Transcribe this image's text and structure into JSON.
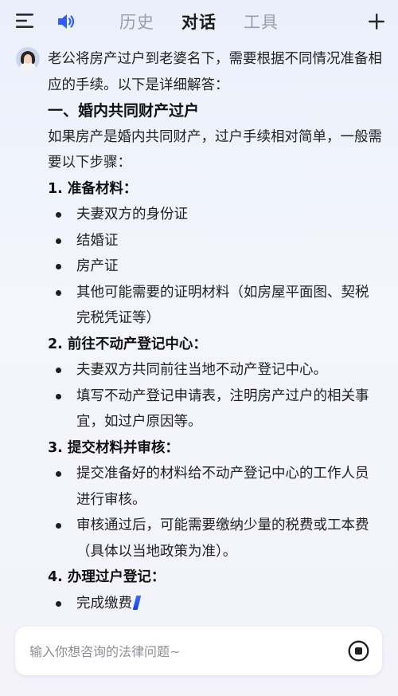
{
  "header": {
    "tabs": [
      {
        "label": "历史"
      },
      {
        "label": "对话"
      },
      {
        "label": "工具"
      }
    ],
    "active_tab": "对话"
  },
  "message": {
    "intro": "老公将房产过户到老婆名下，需要根据不同情况准备相应的手续。以下是详细解答：",
    "section_title": "一、婚内共同财产过户",
    "section_intro": "如果房产是婚内共同财产，过户手续相对简单，一般需要以下步骤：",
    "steps": [
      {
        "title": "1. 准备材料：",
        "items": [
          "夫妻双方的身份证",
          "结婚证",
          "房产证",
          "其他可能需要的证明材料（如房屋平面图、契税完税凭证等）"
        ]
      },
      {
        "title": "2. 前往不动产登记中心：",
        "items": [
          "夫妻双方共同前往当地不动产登记中心。",
          "填写不动产登记申请表，注明房产过户的相关事宜，如过户原因等。"
        ]
      },
      {
        "title": "3. 提交材料并审核：",
        "items": [
          "提交准备好的材料给不动产登记中心的工作人员进行审核。",
          "审核通过后，可能需要缴纳少量的税费或工本费（具体以当地政策为准）。"
        ]
      },
      {
        "title": "4. 办理过户登记：",
        "items": [
          "完成缴费"
        ]
      }
    ]
  },
  "input": {
    "placeholder": "输入你想咨询的法律问题~",
    "value": ""
  },
  "icons": {
    "menu": "menu-icon",
    "speaker": "speaker-icon",
    "new_chat": "plus-icon",
    "stop": "stop-icon",
    "typing_cursor": "typing-cursor-icon"
  },
  "colors": {
    "accent": "#2f5bff",
    "tab_inactive": "#9aa0aa",
    "tab_active": "#1a1a1a"
  }
}
